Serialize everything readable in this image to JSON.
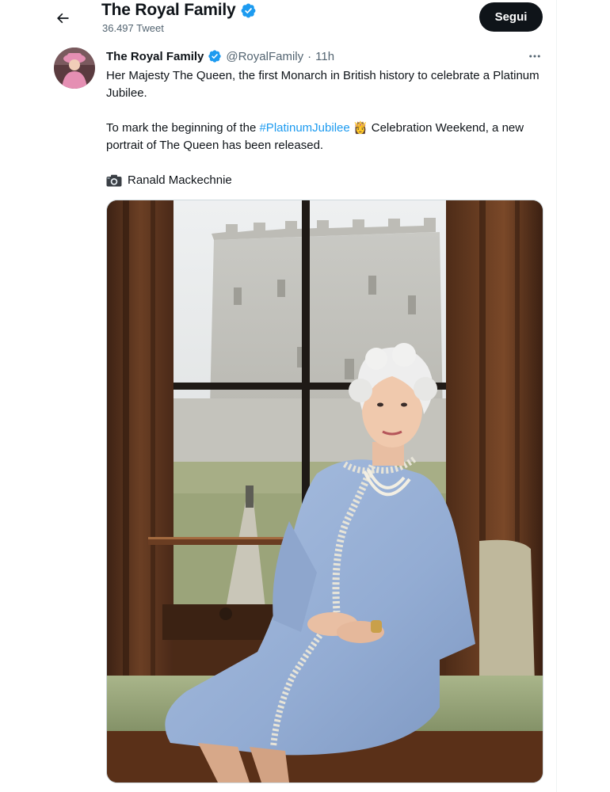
{
  "header": {
    "back_icon": "arrow-left-icon",
    "title": "The Royal Family",
    "verified_icon": "verified-badge-icon",
    "tweet_count": "36.497 Tweet",
    "follow_label": "Segui"
  },
  "tweet": {
    "author": "The Royal Family",
    "handle": "@RoyalFamily",
    "separator": "·",
    "time": "11h",
    "more_icon": "more-dots-icon",
    "line1": "Her Majesty The Queen, the first Monarch in British history to celebrate a Platinum Jubilee.",
    "line2_before": "To mark the beginning of the ",
    "hashtag": "#PlatinumJubilee",
    "hashtag_emoji": "👸",
    "line2_after": " Celebration Weekend, a new portrait of The Queen has been released.",
    "camera_icon": "camera-icon",
    "credit": "Ranald Mackechnie"
  },
  "colors": {
    "accent": "#1d9bf0",
    "text": "#0f1419",
    "secondary": "#536471",
    "verified": "#1d9bf0"
  }
}
